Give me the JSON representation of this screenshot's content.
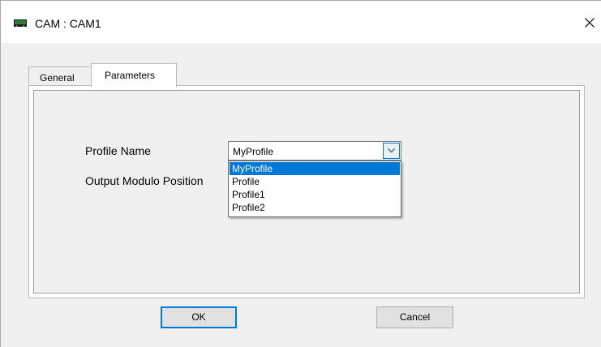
{
  "window": {
    "title": "CAM : CAM1"
  },
  "tabs": [
    {
      "label": "General",
      "active": false
    },
    {
      "label": "Parameters",
      "active": true
    }
  ],
  "form": {
    "profile_name_label": "Profile Name",
    "output_modulo_label": "Output Modulo Position",
    "profile_select": {
      "value": "MyProfile",
      "options": [
        "MyProfile",
        "Profile",
        "Profile1",
        "Profile2"
      ],
      "highlighted": "MyProfile",
      "expanded": true
    }
  },
  "buttons": {
    "ok": "OK",
    "cancel": "Cancel"
  },
  "colors": {
    "accent": "#0078d7",
    "background": "#f0f0f0"
  },
  "icons": {
    "app": "cam-device-icon",
    "close": "close-icon",
    "dropdown": "chevron-down-icon"
  }
}
